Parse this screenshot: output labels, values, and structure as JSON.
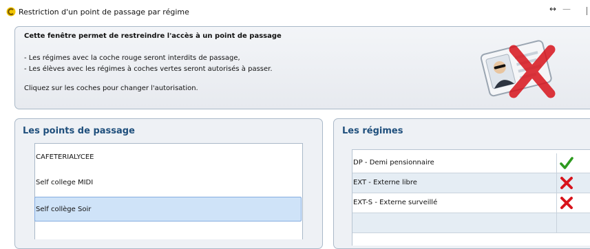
{
  "window": {
    "title": "Restriction d'un point de passage par régime",
    "resize_glyph": "↔",
    "minimize_glyph": "—"
  },
  "info": {
    "title": "Cette fenêtre permet de restreindre l'accès à un point de passage",
    "line1": "- Les régimes avec la coche rouge seront interdits de passage,",
    "line2": "- Les élèves avec les régimes à coches vertes seront autorisés à passer.",
    "line3": "Cliquez sur les coches pour changer l'autorisation.",
    "illustration_icon": "id-card-with-red-cross-icon"
  },
  "points": {
    "title": "Les points de passage",
    "items": [
      {
        "label": "CAFETERIALYCEE",
        "selected": false
      },
      {
        "label": "Self college MIDI",
        "selected": false
      },
      {
        "label": "Self collège Soir",
        "selected": true
      }
    ]
  },
  "regimes": {
    "title": "Les régimes",
    "rows": [
      {
        "label": "DP - Demi pensionnaire",
        "status": "allowed",
        "icon": "green-check-icon"
      },
      {
        "label": "EXT - Externe libre",
        "status": "forbidden",
        "icon": "red-cross-icon"
      },
      {
        "label": "EXT-S - Externe surveillé",
        "status": "forbidden",
        "icon": "red-cross-icon"
      },
      {
        "label": "",
        "status": "",
        "icon": ""
      }
    ]
  },
  "colors": {
    "accent": "#1f4f7c",
    "allowed": "#2e9a1f",
    "forbidden": "#d8141c",
    "selection": "#cfe3f8"
  }
}
